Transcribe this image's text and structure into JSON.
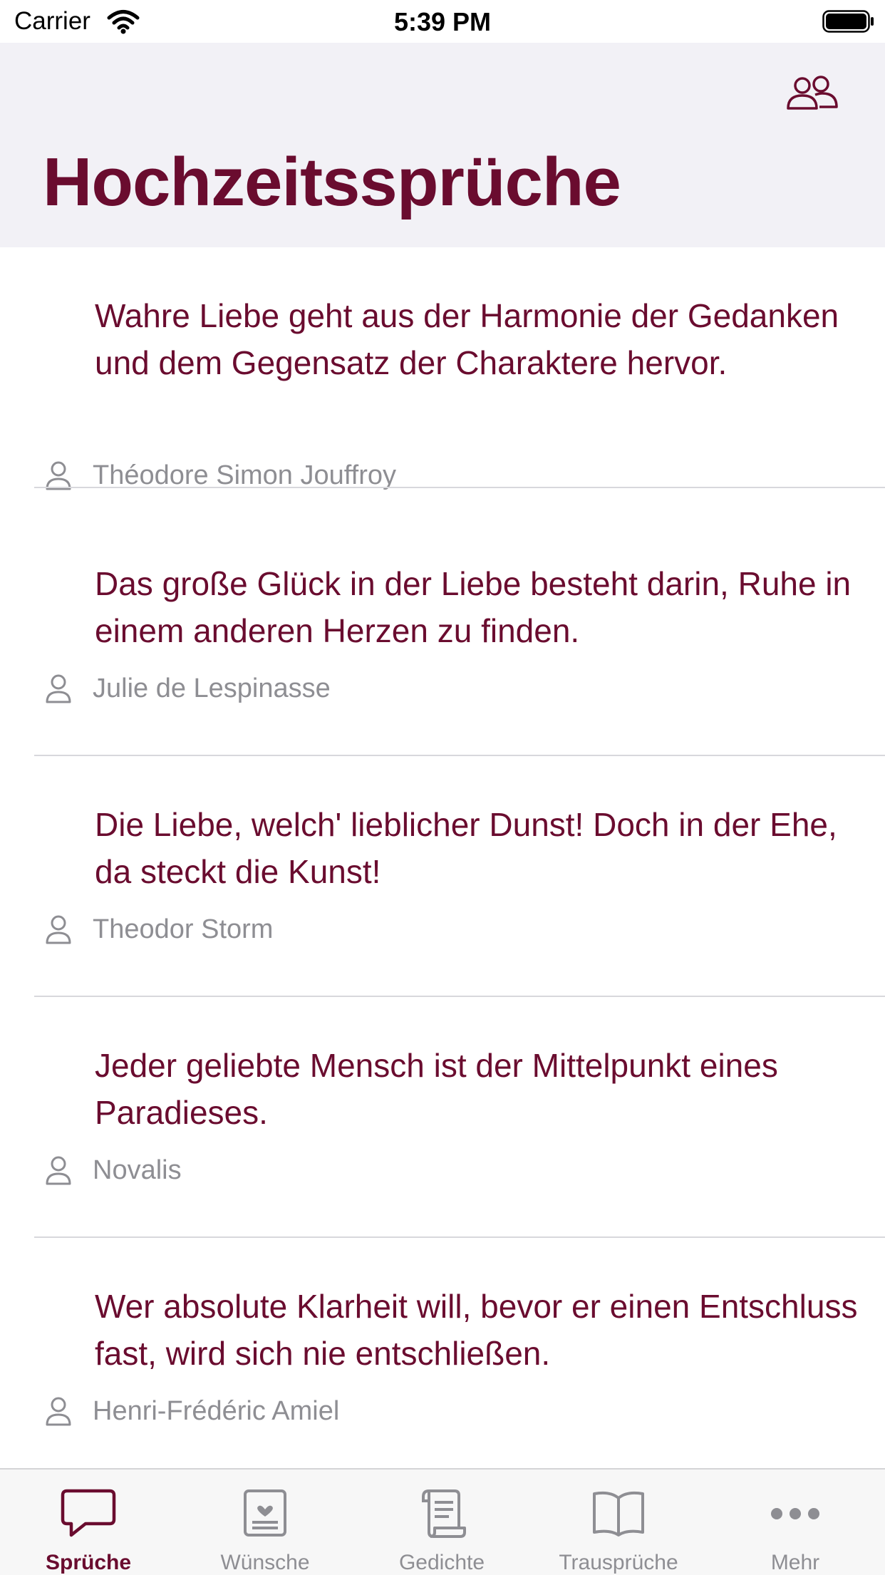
{
  "status_bar": {
    "carrier": "Carrier",
    "time": "5:39 PM"
  },
  "header": {
    "title": "Hochzeitssprüche",
    "action_icon": "people-icon"
  },
  "colors": {
    "accent": "#6a0c2f",
    "secondary_text": "#8e8e93",
    "header_bg": "#f2f1f6"
  },
  "quotes": [
    {
      "text": "Wahre Liebe geht aus der Harmonie der Gedanken und dem Gegensatz der Charaktere hervor.",
      "author": "Théodore Simon Jouffroy"
    },
    {
      "text": "Das große Glück in der Liebe besteht darin, Ruhe in einem anderen Herzen zu finden.",
      "author": "Julie de Lespinasse"
    },
    {
      "text": "Die Liebe, welch' lieblicher Dunst! Doch in der Ehe, da steckt die Kunst!",
      "author": "Theodor Storm"
    },
    {
      "text": "Jeder geliebte Mensch ist der Mittelpunkt eines Paradieses.",
      "author": "Novalis"
    },
    {
      "text": "Wer absolute Klarheit will, bevor er einen Entschluss fast, wird sich nie entschließen.",
      "author": "Henri-Frédéric Amiel"
    }
  ],
  "tabs": [
    {
      "label": "Sprüche",
      "icon": "speech-bubble-icon",
      "active": true
    },
    {
      "label": "Wünsche",
      "icon": "card-icon",
      "active": false
    },
    {
      "label": "Gedichte",
      "icon": "scroll-icon",
      "active": false
    },
    {
      "label": "Trausprüche",
      "icon": "book-icon",
      "active": false
    },
    {
      "label": "Mehr",
      "icon": "more-icon",
      "active": false
    }
  ]
}
